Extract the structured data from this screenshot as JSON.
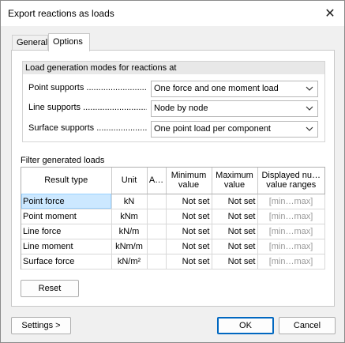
{
  "window": {
    "title": "Export reactions as loads",
    "close_glyph": "✕"
  },
  "tabs": [
    {
      "label": "General",
      "active": false
    },
    {
      "label": "Options",
      "active": true
    }
  ],
  "load_modes": {
    "header": "Load generation modes for reactions at",
    "rows": [
      {
        "label": "Point supports",
        "value": "One force and one moment load"
      },
      {
        "label": "Line supports",
        "value": "Node by node"
      },
      {
        "label": "Surface supports",
        "value": "One point load per component"
      }
    ],
    "chevron_icon": "chevron-down-icon"
  },
  "filter": {
    "label": "Filter generated loads",
    "columns": {
      "result_type": "Result type",
      "unit": "Unit",
      "a": "A…",
      "min_line1": "Minimum",
      "min_line2": "value",
      "max_line1": "Maximum",
      "max_line2": "value",
      "ranges_line1": "Displayed nu…",
      "ranges_line2": "value ranges"
    },
    "rows": [
      {
        "type": "Point force",
        "unit": "kN",
        "min": "Not set",
        "max": "Not set",
        "range": "[min…max]"
      },
      {
        "type": "Point moment",
        "unit": "kNm",
        "min": "Not set",
        "max": "Not set",
        "range": "[min…max]"
      },
      {
        "type": "Line force",
        "unit": "kN/m",
        "min": "Not set",
        "max": "Not set",
        "range": "[min…max]"
      },
      {
        "type": "Line moment",
        "unit": "kNm/m",
        "min": "Not set",
        "max": "Not set",
        "range": "[min…max]"
      },
      {
        "type": "Surface force",
        "unit": "kN/m²",
        "min": "Not set",
        "max": "Not set",
        "range": "[min…max]"
      }
    ],
    "selected_row": 0
  },
  "buttons": {
    "reset": "Reset",
    "settings": "Settings >",
    "ok": "OK",
    "cancel": "Cancel"
  },
  "colors": {
    "selection": "#cce8ff",
    "default_button_border": "#0067c0"
  }
}
